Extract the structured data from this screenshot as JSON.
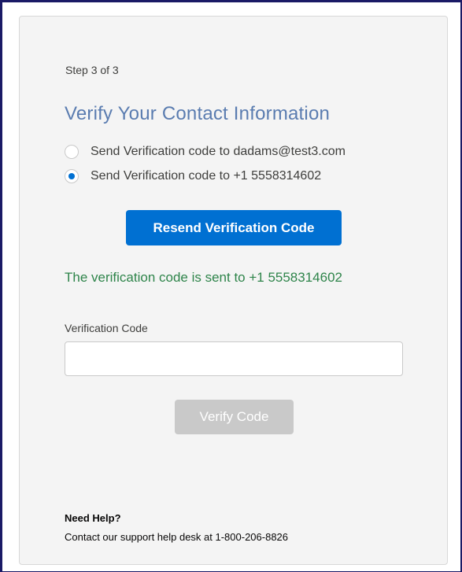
{
  "step": "Step 3 of 3",
  "title": "Verify Your Contact Information",
  "options": [
    {
      "label": "Send Verification code to dadams@test3.com",
      "checked": false
    },
    {
      "label": "Send Verification code to +1 5558314602",
      "checked": true
    }
  ],
  "resend_button": "Resend Verification Code",
  "sent_message": "The verification code is sent to +1 5558314602",
  "code_field": {
    "label": "Verification Code",
    "value": "",
    "placeholder": ""
  },
  "verify_button": "Verify Code",
  "help": {
    "title": "Need Help?",
    "text": "Contact our support help desk at 1-800-206-8826"
  },
  "colors": {
    "title": "#5a7cb0",
    "primary": "#0070d2",
    "success": "#2e844a",
    "disabled": "#c9c9c9"
  }
}
